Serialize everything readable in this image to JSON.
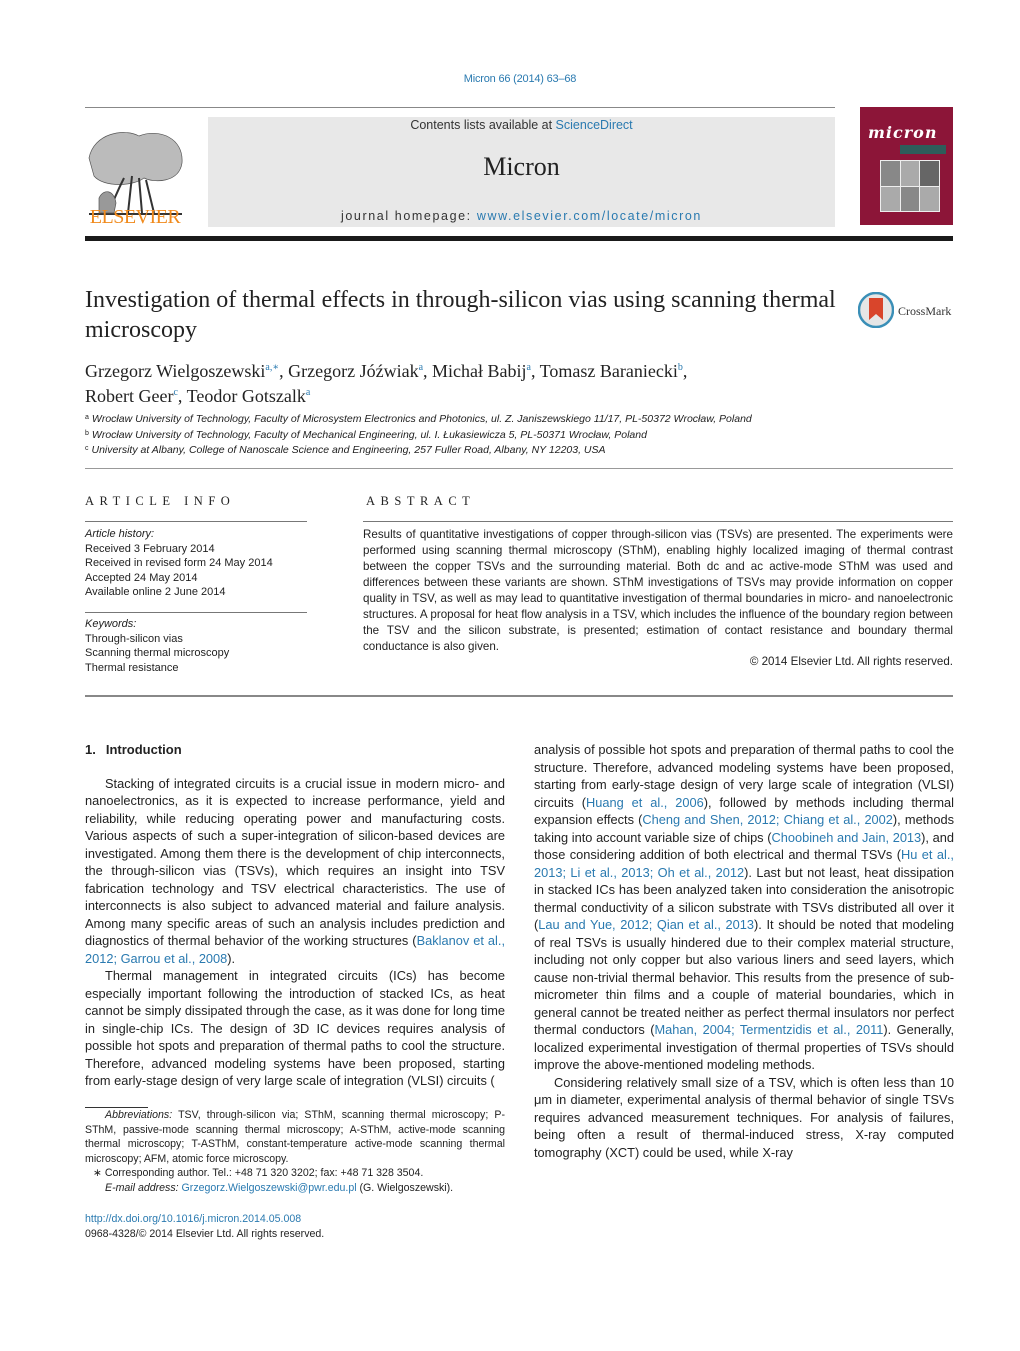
{
  "header": {
    "citation": "Micron 66 (2014) 63–68",
    "contents_prefix": "Contents lists available at ",
    "contents_link": "ScienceDirect",
    "journal_name": "Micron",
    "homepage_prefix": "journal homepage: ",
    "homepage_link": "www.elsevier.com/locate/micron",
    "publisher_logo_text": "ELSEVIER",
    "cover_title": "micron",
    "colors": {
      "link": "#2a7ab0",
      "elsevier_orange": "#f08a1c",
      "cover_maroon": "#8c1538"
    }
  },
  "article": {
    "title": "Investigation of thermal effects in through-silicon vias using scanning thermal microscopy",
    "crossmark_label": "CrossMark",
    "authors": [
      {
        "name": "Grzegorz Wielgoszewski",
        "sup": "a,∗",
        "sep": ", "
      },
      {
        "name": "Grzegorz Jóźwiak",
        "sup": "a",
        "sep": ", "
      },
      {
        "name": "Michał Babij",
        "sup": "a",
        "sep": ", "
      },
      {
        "name": "Tomasz Baraniecki",
        "sup": "b",
        "sep": ","
      },
      {
        "name": "Robert Geer",
        "sup": "c",
        "sep": ", "
      },
      {
        "name": "Teodor Gotszalk",
        "sup": "a",
        "sep": ""
      }
    ],
    "affiliations": [
      {
        "key": "a",
        "text": "Wrocław University of Technology, Faculty of Microsystem Electronics and Photonics, ul. Z. Janiszewskiego 11/17, PL-50372 Wrocław, Poland"
      },
      {
        "key": "b",
        "text": "Wrocław University of Technology, Faculty of Mechanical Engineering, ul. I. Łukasiewicza 5, PL-50371 Wrocław, Poland"
      },
      {
        "key": "c",
        "text": "University at Albany, College of Nanoscale Science and Engineering, 257 Fuller Road, Albany, NY 12203, USA"
      }
    ]
  },
  "article_info": {
    "heading": "ARTICLE INFO",
    "history_label": "Article history:",
    "history": [
      "Received 3 February 2014",
      "Received in revised form 24 May 2014",
      "Accepted 24 May 2014",
      "Available online 2 June 2014"
    ],
    "keywords_label": "Keywords:",
    "keywords": [
      "Through-silicon vias",
      "Scanning thermal microscopy",
      "Thermal resistance"
    ]
  },
  "abstract": {
    "heading": "ABSTRACT",
    "text": "Results of quantitative investigations of copper through-silicon vias (TSVs) are presented. The experiments were performed using scanning thermal microscopy (SThM), enabling highly localized imaging of thermal contrast between the copper TSVs and the surrounding material. Both dc and ac active-mode SThM was used and differences between these variants are shown. SThM investigations of TSVs may provide information on copper quality in TSV, as well as may lead to quantitative investigation of thermal boundaries in micro- and nanoelectronic structures. A proposal for heat flow analysis in a TSV, which includes the influence of the boundary region between the TSV and the silicon substrate, is presented; estimation of contact resistance and boundary thermal conductance is also given.",
    "copyright": "© 2014 Elsevier Ltd. All rights reserved."
  },
  "body": {
    "section_number": "1.",
    "section_title": "Introduction",
    "p1": {
      "t1": "Stacking of integrated circuits is a crucial issue in modern micro- and nanoelectronics, as it is expected to increase performance, yield and reliability, while reducing operating power and manufacturing costs. Various aspects of such a super-integration of silicon-based devices are investigated. Among them there is the development of chip interconnects, the through-silicon vias (TSVs), which requires an insight into TSV fabrication technology and TSV electrical characteristics. The use of interconnects is also subject to advanced material and failure analysis. Among many specific areas of such an analysis includes prediction and diagnostics of thermal behavior of the working structures (",
      "ref1": "Baklanov et al., 2012; Garrou et al., 2008",
      "t2": ")."
    },
    "p2": {
      "t1": "Thermal management in integrated circuits (ICs) has become especially important following the introduction of stacked ICs, as heat cannot be simply dissipated through the case, as it was done for long time in single-chip ICs. The design of 3D IC devices requires analysis of possible hot spots and preparation of thermal paths to cool the structure. Therefore, advanced modeling systems have been proposed, starting from early-stage design of very large scale of integration (VLSI) circuits (",
      "ref1": "Huang et al., 2006",
      "t2": "), followed by methods including thermal expansion effects (",
      "ref2": "Cheng and Shen, 2012; Chiang et al., 2002",
      "t3": "), methods taking into account variable size of chips (",
      "ref3": "Choobineh and Jain, 2013",
      "t4": "), and those considering addition of both electrical and thermal TSVs (",
      "ref4": "Hu et al., 2013; Li et al., 2013; Oh et al., 2012",
      "t5": "). Last but not least, heat dissipation in stacked ICs has been analyzed taken into consideration the anisotropic thermal conductivity of a silicon substrate with TSVs distributed all over it (",
      "ref5": "Lau and Yue, 2012; Qian et al., 2013",
      "t6": "). It should be noted that modeling of real TSVs is usually hindered due to their complex material structure, including not only copper but also various liners and seed layers, which cause non-trivial thermal behavior. This results from the presence of sub-micrometer thin films and a couple of material boundaries, which in general cannot be treated neither as perfect thermal insulators nor perfect thermal conductors (",
      "ref6": "Mahan, 2004; Termentzidis et al., 2011",
      "t7": "). Generally, localized experimental investigation of thermal properties of TSVs should improve the above-mentioned modeling methods."
    },
    "p3": "Considering relatively small size of a TSV, which is often less than 10 μm in diameter, experimental analysis of thermal behavior of single TSVs requires advanced measurement techniques. For analysis of failures, being often a result of thermal-induced stress, X-ray computed tomography (XCT) could be used, while X-ray"
  },
  "footnotes": {
    "abbrev_label": "Abbreviations:",
    "abbrev_text": " TSV, through-silicon via; SThM, scanning thermal microscopy; P-SThM, passive-mode scanning thermal microscopy; A-SThM, active-mode scanning thermal microscopy; T-ASThM, constant-temperature active-mode scanning thermal microscopy; AFM, atomic force microscopy.",
    "corr_mark": "∗",
    "corr_text": " Corresponding author. Tel.: +48 71 320 3202; fax: +48 71 328 3504.",
    "email_label": "E-mail address:",
    "email": "Grzegorz.Wielgoszewski@pwr.edu.pl",
    "email_suffix": " (G. Wielgoszewski).",
    "doi": "http://dx.doi.org/10.1016/j.micron.2014.05.008",
    "issn": "0968-4328/© 2014 Elsevier Ltd. All rights reserved."
  }
}
